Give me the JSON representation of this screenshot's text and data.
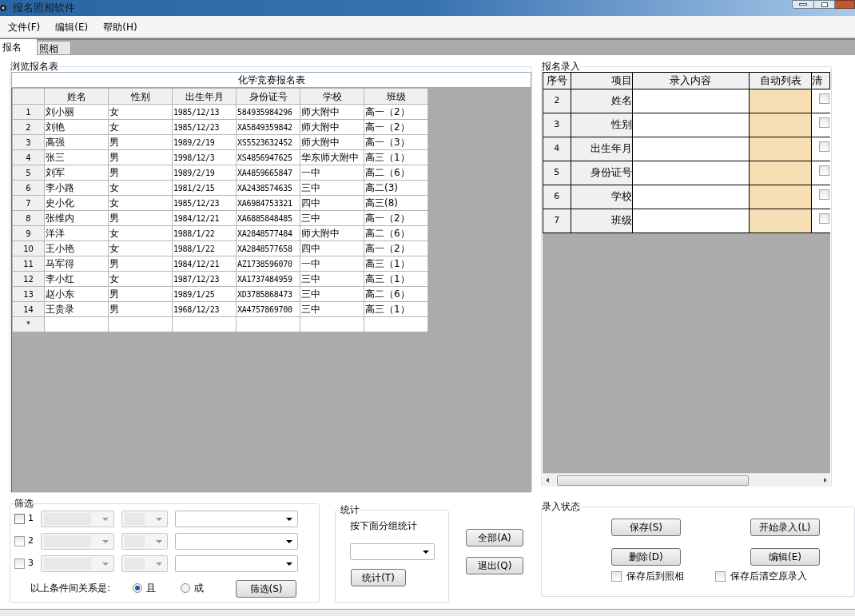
{
  "window": {
    "title": "报名照相软件"
  },
  "menu": [
    "文件(F)",
    "编辑(E)",
    "帮助(H)"
  ],
  "tabs": [
    {
      "label": "报名",
      "selected": true
    },
    {
      "label": "照相",
      "selected": false
    }
  ],
  "browse": {
    "legend": "浏览报名表",
    "table_title": "化学竞赛报名表",
    "columns": [
      "姓名",
      "性别",
      "出生年月",
      "身份证号",
      "学校",
      "班级"
    ],
    "rows": [
      {
        "index": "1",
        "cells": [
          "刘小丽",
          "女",
          "1985/12/13",
          "584935984296",
          "师大附中",
          "高一（2）"
        ]
      },
      {
        "index": "2",
        "cells": [
          "刘艳",
          "女",
          "1985/12/23",
          "XA5849359842",
          "师大附中",
          "高一（2）"
        ]
      },
      {
        "index": "3",
        "cells": [
          "高强",
          "男",
          "1989/2/19",
          "XS5523632452",
          "师大附中",
          "高一（3）"
        ]
      },
      {
        "index": "4",
        "cells": [
          "张三",
          "男",
          "1998/12/3",
          "XS4856947625",
          "华东师大附中",
          "高三（1）"
        ]
      },
      {
        "index": "5",
        "cells": [
          "刘军",
          "男",
          "1989/2/19",
          "XA4859665847",
          "一中",
          "高二（6）"
        ]
      },
      {
        "index": "6",
        "cells": [
          "李小路",
          "女",
          "1981/2/15",
          "XA2438574635",
          "三中",
          "高二(3)"
        ]
      },
      {
        "index": "7",
        "cells": [
          "史小化",
          "女",
          "1985/12/23",
          "XA6984753321",
          "四中",
          "高三(8)"
        ]
      },
      {
        "index": "8",
        "cells": [
          "张维内",
          "男",
          "1984/12/21",
          "XA6885848485",
          "三中",
          "高一（2）"
        ]
      },
      {
        "index": "9",
        "cells": [
          "洋洋",
          "女",
          "1988/1/22",
          "XA2848577484",
          "师大附中",
          "高二（6）"
        ]
      },
      {
        "index": "10",
        "cells": [
          "王小艳",
          "女",
          "1988/1/22",
          "XA2848577658",
          "四中",
          "高一（2）"
        ]
      },
      {
        "index": "11",
        "cells": [
          "马军得",
          "男",
          "1984/12/21",
          "AZ1738596070",
          "一中",
          "高三（1）"
        ]
      },
      {
        "index": "12",
        "cells": [
          "李小红",
          "女",
          "1987/12/23",
          "XA1737484959",
          "三中",
          "高三（1）"
        ]
      },
      {
        "index": "13",
        "cells": [
          "赵小东",
          "男",
          "1989/1/25",
          "XD3785868473",
          "三中",
          "高二（6）"
        ]
      },
      {
        "index": "14",
        "cells": [
          "王贵录",
          "男",
          "1968/12/23",
          "XA4757869700",
          "三中",
          "高三（1）"
        ]
      }
    ],
    "new_row_marker": "＊"
  },
  "entry": {
    "legend": "报名录入",
    "columns": [
      "序号",
      "项目",
      "录入内容",
      "自动列表",
      "清"
    ],
    "rows": [
      {
        "index": "2",
        "item": "姓名",
        "checked": false
      },
      {
        "index": "3",
        "item": "性别",
        "checked": false
      },
      {
        "index": "4",
        "item": "出生年月",
        "checked": false
      },
      {
        "index": "5",
        "item": "身份证号",
        "checked": false
      },
      {
        "index": "6",
        "item": "学校",
        "checked": false
      },
      {
        "index": "7",
        "item": "班级",
        "checked": false
      }
    ]
  },
  "filter": {
    "legend": "筛选",
    "rows": [
      {
        "label": "1",
        "checked": false,
        "combos": [
          {
            "disabled": true
          },
          {
            "disabled": true
          },
          {
            "disabled": false
          }
        ]
      },
      {
        "label": "2",
        "checked": false,
        "combos": [
          {
            "disabled": true
          },
          {
            "disabled": true
          },
          {
            "disabled": false
          }
        ]
      },
      {
        "label": "3",
        "checked": false,
        "combos": [
          {
            "disabled": true
          },
          {
            "disabled": true
          },
          {
            "disabled": false
          }
        ]
      }
    ],
    "relation_label": "以上条件间关系是:",
    "options": [
      {
        "label": "且",
        "selected": true
      },
      {
        "label": "或",
        "selected": false
      }
    ],
    "button": "筛选(S)"
  },
  "stats": {
    "legend": "统计",
    "hint": "按下面分组统计",
    "button": "统计(T)"
  },
  "side_buttons": [
    "全部(A)",
    "退出(Q)"
  ],
  "entry_status": {
    "legend": "录入状态",
    "buttons": [
      "保存(S)",
      "开始录入(L)",
      "删除(D)",
      "编辑(E)"
    ],
    "options": [
      {
        "label": "保存后到照相",
        "checked": false
      },
      {
        "label": "保存后清空原录入",
        "checked": false
      }
    ]
  }
}
